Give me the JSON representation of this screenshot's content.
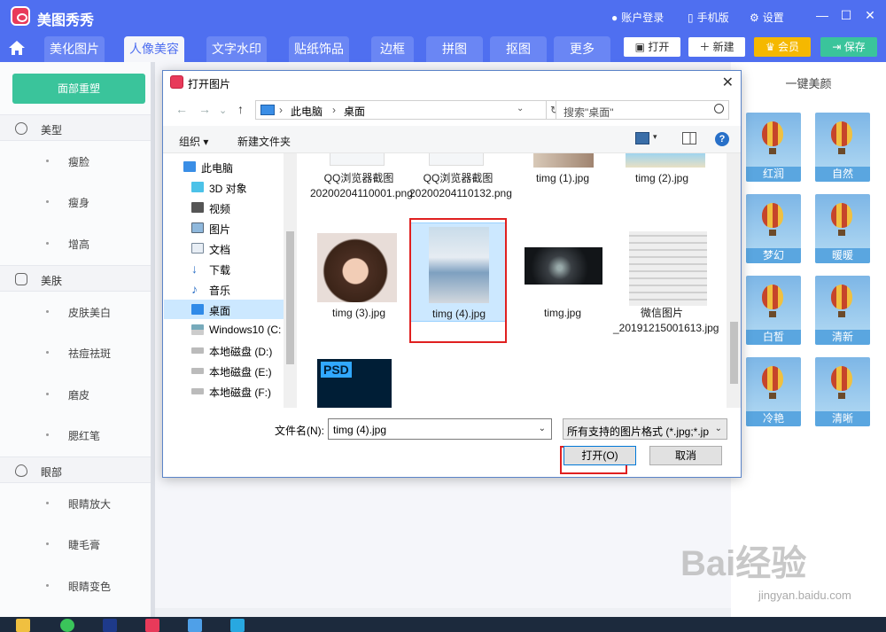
{
  "app": {
    "title": "美图秀秀",
    "top_right": [
      "账户登录",
      "手机版",
      "设置"
    ]
  },
  "tabs": [
    {
      "label": "美化图片"
    },
    {
      "label": "人像美容"
    },
    {
      "label": "文字水印"
    },
    {
      "label": "贴纸饰品"
    },
    {
      "label": "边框"
    },
    {
      "label": "拼图"
    },
    {
      "label": "抠图"
    },
    {
      "label": "更多"
    }
  ],
  "toolbar": {
    "open": "打开",
    "new": "新建",
    "vip": "会员",
    "save": "保存"
  },
  "sidebar": {
    "reset": "面部重塑",
    "groups": [
      {
        "label": "美型",
        "items": [
          "瘦脸",
          "瘦身",
          "增高"
        ]
      },
      {
        "label": "美肤",
        "items": [
          "皮肤美白",
          "祛痘祛斑",
          "磨皮",
          "腮红笔"
        ]
      },
      {
        "label": "眼部",
        "items": [
          "眼睛放大",
          "睫毛膏",
          "眼睛变色"
        ]
      }
    ]
  },
  "right_panel": {
    "title": "一键美颜",
    "presets": [
      "红润",
      "自然",
      "梦幻",
      "暖暖",
      "白皙",
      "清新",
      "冷艳",
      "清晰"
    ]
  },
  "dialog": {
    "title": "打开图片",
    "breadcrumb": [
      "此电脑",
      "桌面"
    ],
    "search_placeholder": "搜索\"桌面\"",
    "organize": "组织 ▾",
    "new_folder": "新建文件夹",
    "tree": [
      "此电脑",
      "3D 对象",
      "视频",
      "图片",
      "文档",
      "下载",
      "音乐",
      "桌面",
      "Windows10 (C:",
      "本地磁盘 (D:)",
      "本地磁盘 (E:)",
      "本地磁盘 (F:)"
    ],
    "files": [
      {
        "name": "QQ浏览器截图20200204110001.png"
      },
      {
        "name": "QQ浏览器截图20200204110132.png"
      },
      {
        "name": "timg (1).jpg"
      },
      {
        "name": "timg (2).jpg"
      },
      {
        "name": "timg (3).jpg"
      },
      {
        "name": "timg (4).jpg"
      },
      {
        "name": "timg.jpg"
      },
      {
        "name": "微信图片_20191215001613.jpg"
      },
      {
        "name": "PSD"
      }
    ],
    "filename_label": "文件名(N):",
    "filename_value": "timg (4).jpg",
    "filetype": "所有支持的图片格式 (*.jpg;*.jp",
    "open_button": "打开(O)",
    "cancel_button": "取消"
  },
  "watermark": {
    "brand": "Bai经验",
    "url": "jingyan.baidu.com"
  },
  "colors": {
    "brand_blue": "#4f6ff0",
    "green": "#3ac49b",
    "vip": "#f5b800",
    "selection": "#cce8ff",
    "highlight": "#e02020"
  }
}
